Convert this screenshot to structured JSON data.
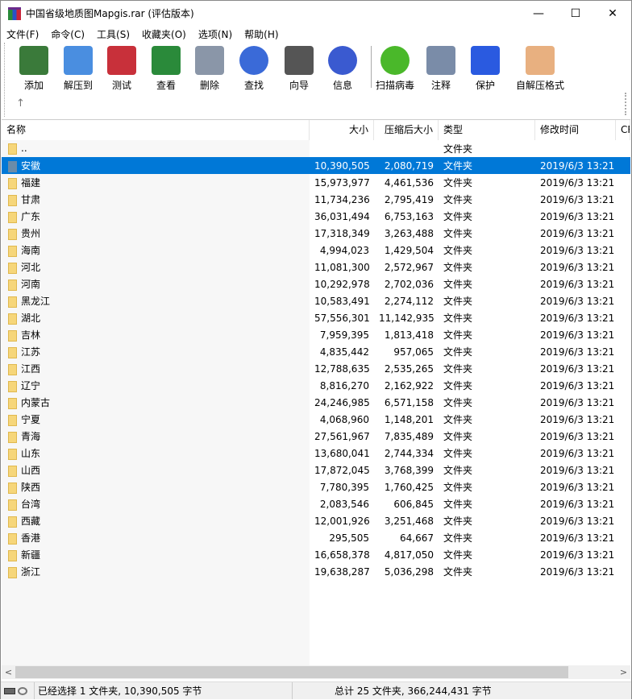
{
  "window": {
    "title": "中国省级地质图Mapgis.rar (评估版本)",
    "min": "—",
    "max": "☐",
    "close": "✕"
  },
  "menu": [
    "文件(F)",
    "命令(C)",
    "工具(S)",
    "收藏夹(O)",
    "选项(N)",
    "帮助(H)"
  ],
  "toolbar": [
    {
      "label": "添加",
      "icon": "add-archive-icon",
      "color": "#3a7a3a"
    },
    {
      "label": "解压到",
      "icon": "extract-folder-icon",
      "color": "#4a8ee0"
    },
    {
      "label": "测试",
      "icon": "test-clipboard-icon",
      "color": "#c8303a"
    },
    {
      "label": "查看",
      "icon": "view-book-icon",
      "color": "#2a8a3a"
    },
    {
      "label": "删除",
      "icon": "trash-icon",
      "color": "#8a96a8"
    },
    {
      "label": "查找",
      "icon": "magnifier-icon",
      "color": "#3a6ad8"
    },
    {
      "label": "向导",
      "icon": "wizard-wand-icon",
      "color": "#555555"
    },
    {
      "label": "信息",
      "icon": "info-icon",
      "color": "#3a5ad0"
    },
    {
      "label": "扫描病毒",
      "icon": "virus-scan-icon",
      "color": "#4ab82a"
    },
    {
      "label": "注释",
      "icon": "comment-icon",
      "color": "#7a8ca8"
    },
    {
      "label": "保护",
      "icon": "shield-icon",
      "color": "#2a5ae0"
    },
    {
      "label": "自解压格式",
      "icon": "sfx-box-icon",
      "color": "#e8b080"
    }
  ],
  "up": "↑",
  "columns": {
    "name": "名称",
    "size": "大小",
    "packed": "压缩后大小",
    "type": "类型",
    "modified": "修改时间",
    "crc": "CR"
  },
  "parent_row": {
    "name": "..",
    "type": "文件夹"
  },
  "rows": [
    {
      "name": "安徽",
      "size": "10,390,505",
      "packed": "2,080,719",
      "type": "文件夹",
      "modified": "2019/6/3 13:21"
    },
    {
      "name": "福建",
      "size": "15,973,977",
      "packed": "4,461,536",
      "type": "文件夹",
      "modified": "2019/6/3 13:21"
    },
    {
      "name": "甘肃",
      "size": "11,734,236",
      "packed": "2,795,419",
      "type": "文件夹",
      "modified": "2019/6/3 13:21"
    },
    {
      "name": "广东",
      "size": "36,031,494",
      "packed": "6,753,163",
      "type": "文件夹",
      "modified": "2019/6/3 13:21"
    },
    {
      "name": "贵州",
      "size": "17,318,349",
      "packed": "3,263,488",
      "type": "文件夹",
      "modified": "2019/6/3 13:21"
    },
    {
      "name": "海南",
      "size": "4,994,023",
      "packed": "1,429,504",
      "type": "文件夹",
      "modified": "2019/6/3 13:21"
    },
    {
      "name": "河北",
      "size": "11,081,300",
      "packed": "2,572,967",
      "type": "文件夹",
      "modified": "2019/6/3 13:21"
    },
    {
      "name": "河南",
      "size": "10,292,978",
      "packed": "2,702,036",
      "type": "文件夹",
      "modified": "2019/6/3 13:21"
    },
    {
      "name": "黑龙江",
      "size": "10,583,491",
      "packed": "2,274,112",
      "type": "文件夹",
      "modified": "2019/6/3 13:21"
    },
    {
      "name": "湖北",
      "size": "57,556,301",
      "packed": "11,142,935",
      "type": "文件夹",
      "modified": "2019/6/3 13:21"
    },
    {
      "name": "吉林",
      "size": "7,959,395",
      "packed": "1,813,418",
      "type": "文件夹",
      "modified": "2019/6/3 13:21"
    },
    {
      "name": "江苏",
      "size": "4,835,442",
      "packed": "957,065",
      "type": "文件夹",
      "modified": "2019/6/3 13:21"
    },
    {
      "name": "江西",
      "size": "12,788,635",
      "packed": "2,535,265",
      "type": "文件夹",
      "modified": "2019/6/3 13:21"
    },
    {
      "name": "辽宁",
      "size": "8,816,270",
      "packed": "2,162,922",
      "type": "文件夹",
      "modified": "2019/6/3 13:21"
    },
    {
      "name": "内蒙古",
      "size": "24,246,985",
      "packed": "6,571,158",
      "type": "文件夹",
      "modified": "2019/6/3 13:21"
    },
    {
      "name": "宁夏",
      "size": "4,068,960",
      "packed": "1,148,201",
      "type": "文件夹",
      "modified": "2019/6/3 13:21"
    },
    {
      "name": "青海",
      "size": "27,561,967",
      "packed": "7,835,489",
      "type": "文件夹",
      "modified": "2019/6/3 13:21"
    },
    {
      "name": "山东",
      "size": "13,680,041",
      "packed": "2,744,334",
      "type": "文件夹",
      "modified": "2019/6/3 13:21"
    },
    {
      "name": "山西",
      "size": "17,872,045",
      "packed": "3,768,399",
      "type": "文件夹",
      "modified": "2019/6/3 13:21"
    },
    {
      "name": "陕西",
      "size": "7,780,395",
      "packed": "1,760,425",
      "type": "文件夹",
      "modified": "2019/6/3 13:21"
    },
    {
      "name": "台湾",
      "size": "2,083,546",
      "packed": "606,845",
      "type": "文件夹",
      "modified": "2019/6/3 13:21"
    },
    {
      "name": "西藏",
      "size": "12,001,926",
      "packed": "3,251,468",
      "type": "文件夹",
      "modified": "2019/6/3 13:21"
    },
    {
      "name": "香港",
      "size": "295,505",
      "packed": "64,667",
      "type": "文件夹",
      "modified": "2019/6/3 13:21"
    },
    {
      "name": "新疆",
      "size": "16,658,378",
      "packed": "4,817,050",
      "type": "文件夹",
      "modified": "2019/6/3 13:21"
    },
    {
      "name": "浙江",
      "size": "19,638,287",
      "packed": "5,036,298",
      "type": "文件夹",
      "modified": "2019/6/3 13:21"
    }
  ],
  "selected_index": 0,
  "status": {
    "selected": "已经选择 1 文件夹, 10,390,505 字节",
    "total": "总计 25 文件夹, 366,244,431 字节"
  }
}
